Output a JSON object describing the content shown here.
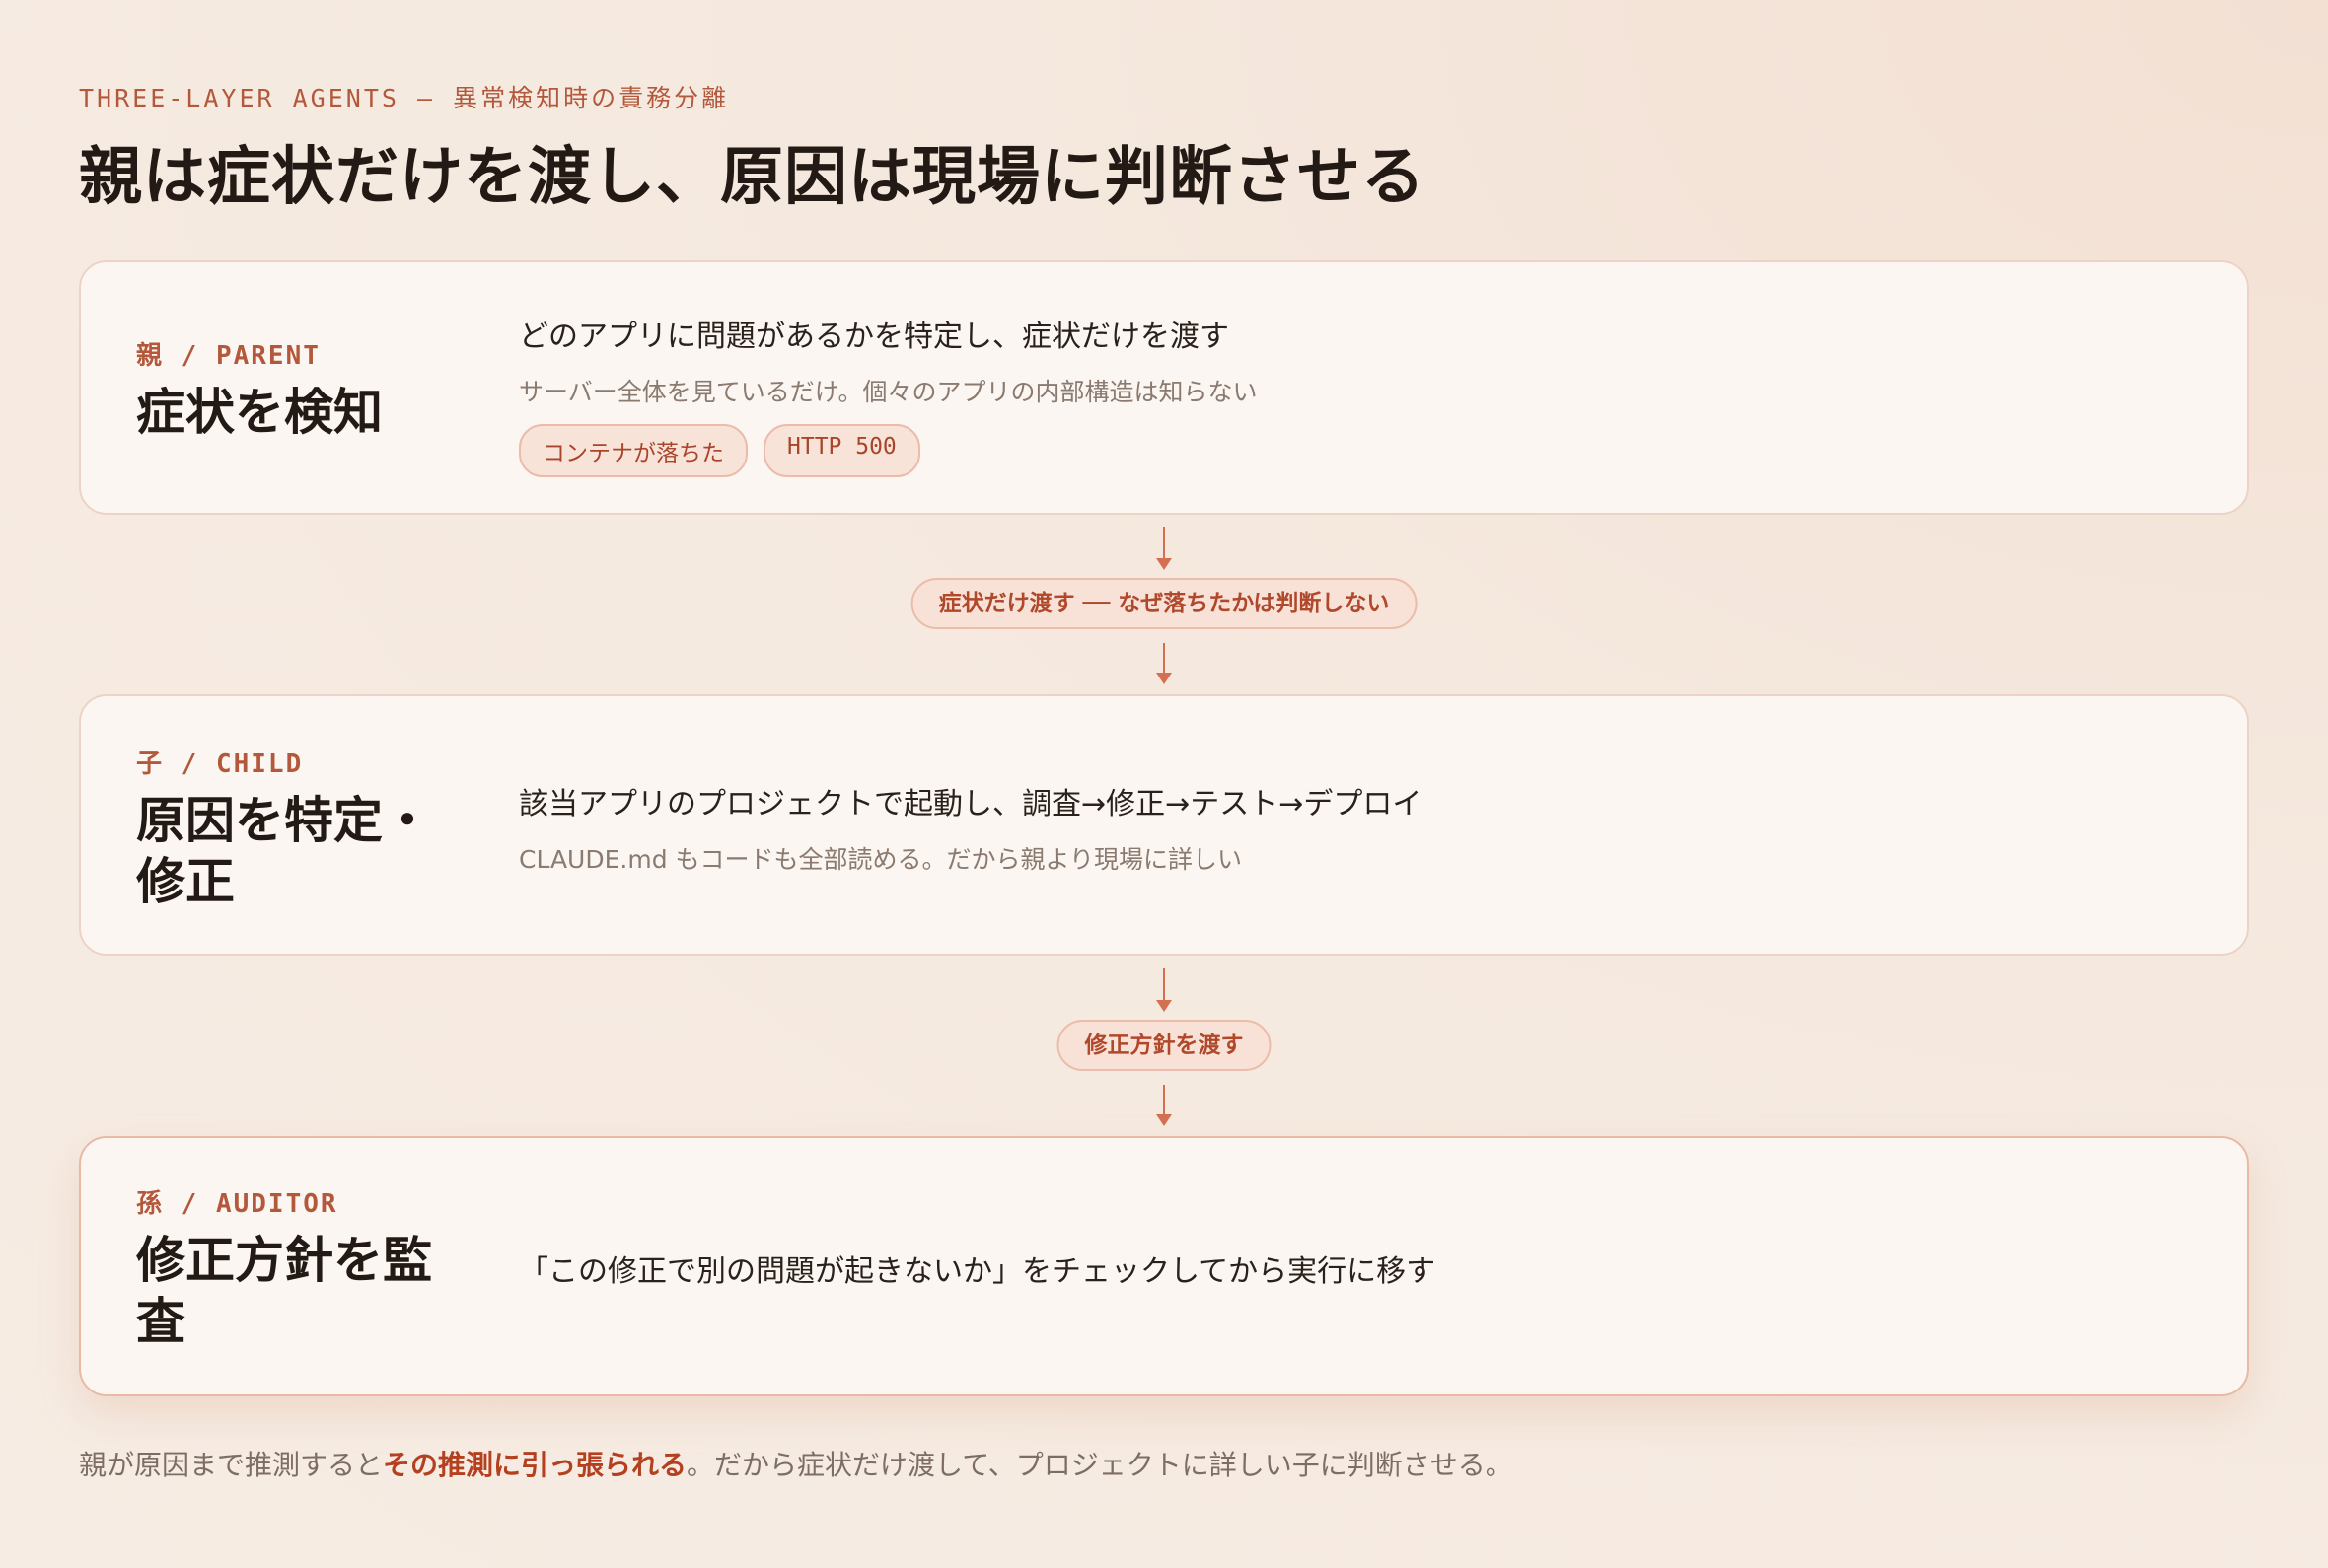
{
  "header": {
    "eyebrow": "THREE-LAYER AGENTS — 異常検知時の責務分離",
    "title": "親は症状だけを渡し、原因は現場に判断させる"
  },
  "layers": [
    {
      "role": "親 / PARENT",
      "task": "症状を検知",
      "main": "どのアプリに問題があるかを特定し、症状だけを渡す",
      "sub": "サーバー全体を見ているだけ。個々のアプリの内部構造は知らない",
      "tags": [
        "コンテナが落ちた",
        "HTTP 500"
      ]
    },
    {
      "role": "子 / CHILD",
      "task": "原因を特定・修正",
      "main": "該当アプリのプロジェクトで起動し、調査→修正→テスト→デプロイ",
      "sub": "CLAUDE.md もコードも全部読める。だから親より現場に詳しい"
    },
    {
      "role": "孫 / AUDITOR",
      "task": "修正方針を監査",
      "main": "「この修正で別の問題が起きないか」をチェックしてから実行に移す"
    }
  ],
  "handoffs": [
    {
      "label": "症状だけ渡す ── なぜ落ちたかは判断しない"
    },
    {
      "label": "修正方針を渡す"
    }
  ],
  "footer": {
    "before": "親が原因まで推測すると",
    "emphasis": "その推測に引っ張られる",
    "after": "。だから症状だけ渡して、プロジェクトに詳しい子に判断させる。"
  },
  "colors": {
    "accent": "#b4583b",
    "arrow": "#d56f52",
    "card_bg": "#fbf6f1",
    "pill_bg": "#f8e1d6"
  }
}
